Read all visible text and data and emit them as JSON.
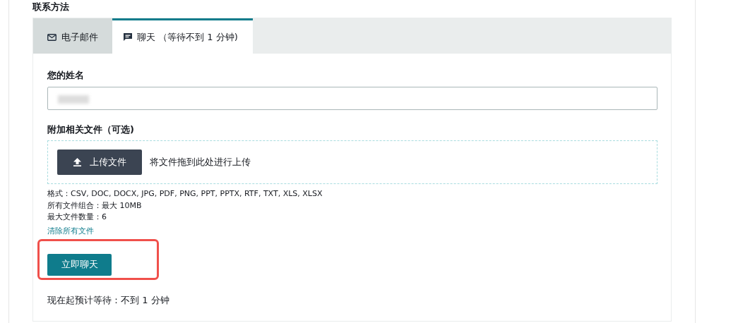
{
  "section_title": "联系方法",
  "tabs": [
    {
      "kind": "mail",
      "label": "电子邮件",
      "selected": false
    },
    {
      "kind": "chat",
      "label": "聊天 （等待不到 1 分钟)",
      "selected": true
    }
  ],
  "name_field": {
    "label": "您的姓名",
    "redacted": true
  },
  "attachments": {
    "label": "附加相关文件（可选)",
    "upload_button": "上传文件",
    "drop_hint": "将文件拖到此处进行上传",
    "notes": [
      "格式：CSV, DOC, DOCX, JPG, PDF, PNG, PPT, PPTX, RTF, TXT, XLS, XLSX",
      "所有文件组合：最大 10MB",
      "最大文件数量：6"
    ],
    "clear_link": "清除所有文件"
  },
  "chat_button": {
    "label": "立即聊天",
    "highlighted": true
  },
  "wait_text": "现在起预计等待：不到 1 分钟"
}
